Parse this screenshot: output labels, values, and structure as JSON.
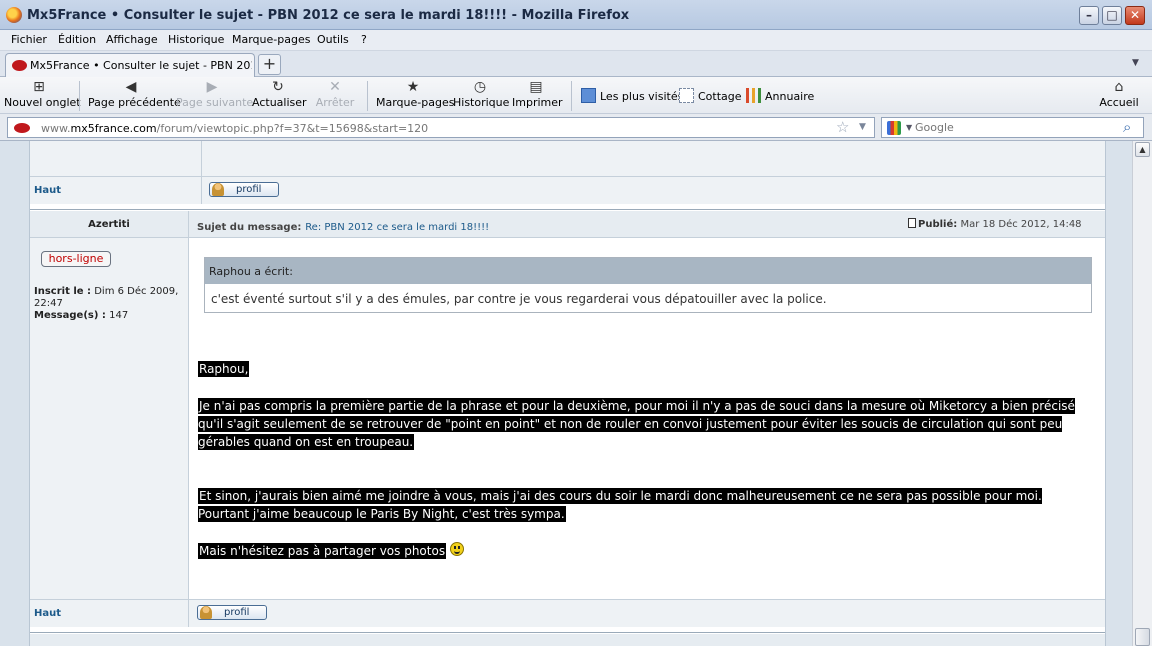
{
  "window": {
    "title": "Mx5France • Consulter le sujet - PBN 2012 ce sera le mardi 18!!!! - Mozilla Firefox"
  },
  "menu": [
    "Fichier",
    "Édition",
    "Affichage",
    "Historique",
    "Marque-pages",
    "Outils",
    "?"
  ],
  "tab": {
    "label": "Mx5France • Consulter le sujet - PBN 2012 c..."
  },
  "toolbar": {
    "new_tab": "Nouvel onglet",
    "back": "Page précédente",
    "forward": "Page suivante",
    "reload": "Actualiser",
    "stop": "Arrêter",
    "bookmarks": "Marque-pages",
    "history": "Historique",
    "print": "Imprimer",
    "home": "Accueil"
  },
  "bookmarks_bar": [
    "Les plus visités",
    "Cottage",
    "Annuaire"
  ],
  "urlbar": {
    "prefix": "www.",
    "domain": "mx5france.com",
    "path": "/forum/viewtopic.php?f=37&t=15698&start=120"
  },
  "search": {
    "placeholder": "Google"
  },
  "forum": {
    "haut_label": "Haut",
    "profil_label": "profil",
    "post": {
      "author": "Azertiti",
      "status": "hors-ligne",
      "inscrit_label": "Inscrit le :",
      "inscrit_value": "Dim 6 Déc 2009, 22:47",
      "messages_label": "Message(s) :",
      "messages_value": "147",
      "subject_label": "Sujet du message:",
      "subject": "Re: PBN 2012 ce sera le mardi 18!!!!",
      "published_label": "Publié:",
      "published_date": "Mar 18 Déc 2012, 14:48",
      "quote_header": "Raphou a écrit:",
      "quote_body": "c'est éventé surtout s'il y a des émules, par contre je vous regarderai vous dépatouiller avec la police.",
      "paragraphs": [
        "Raphou,",
        "Je n'ai pas compris la première partie de la phrase et pour la deuxième, pour moi il n'y a pas de souci dans la mesure où Miketorcy a bien précisé qu'il s'agit seulement de se retrouver de \"point en point\" et non de rouler en convoi justement pour éviter les soucis de circulation qui sont peu gérables quand on est en troupeau.",
        "Et sinon, j'aurais bien aimé me joindre à vous, mais j'ai des cours du soir le mardi donc malheureusement ce ne sera pas possible pour moi. Pourtant j'aime beaucoup le Paris By Night, c'est très sympa.",
        "Mais n'hésitez pas à partager vos photos"
      ]
    }
  }
}
